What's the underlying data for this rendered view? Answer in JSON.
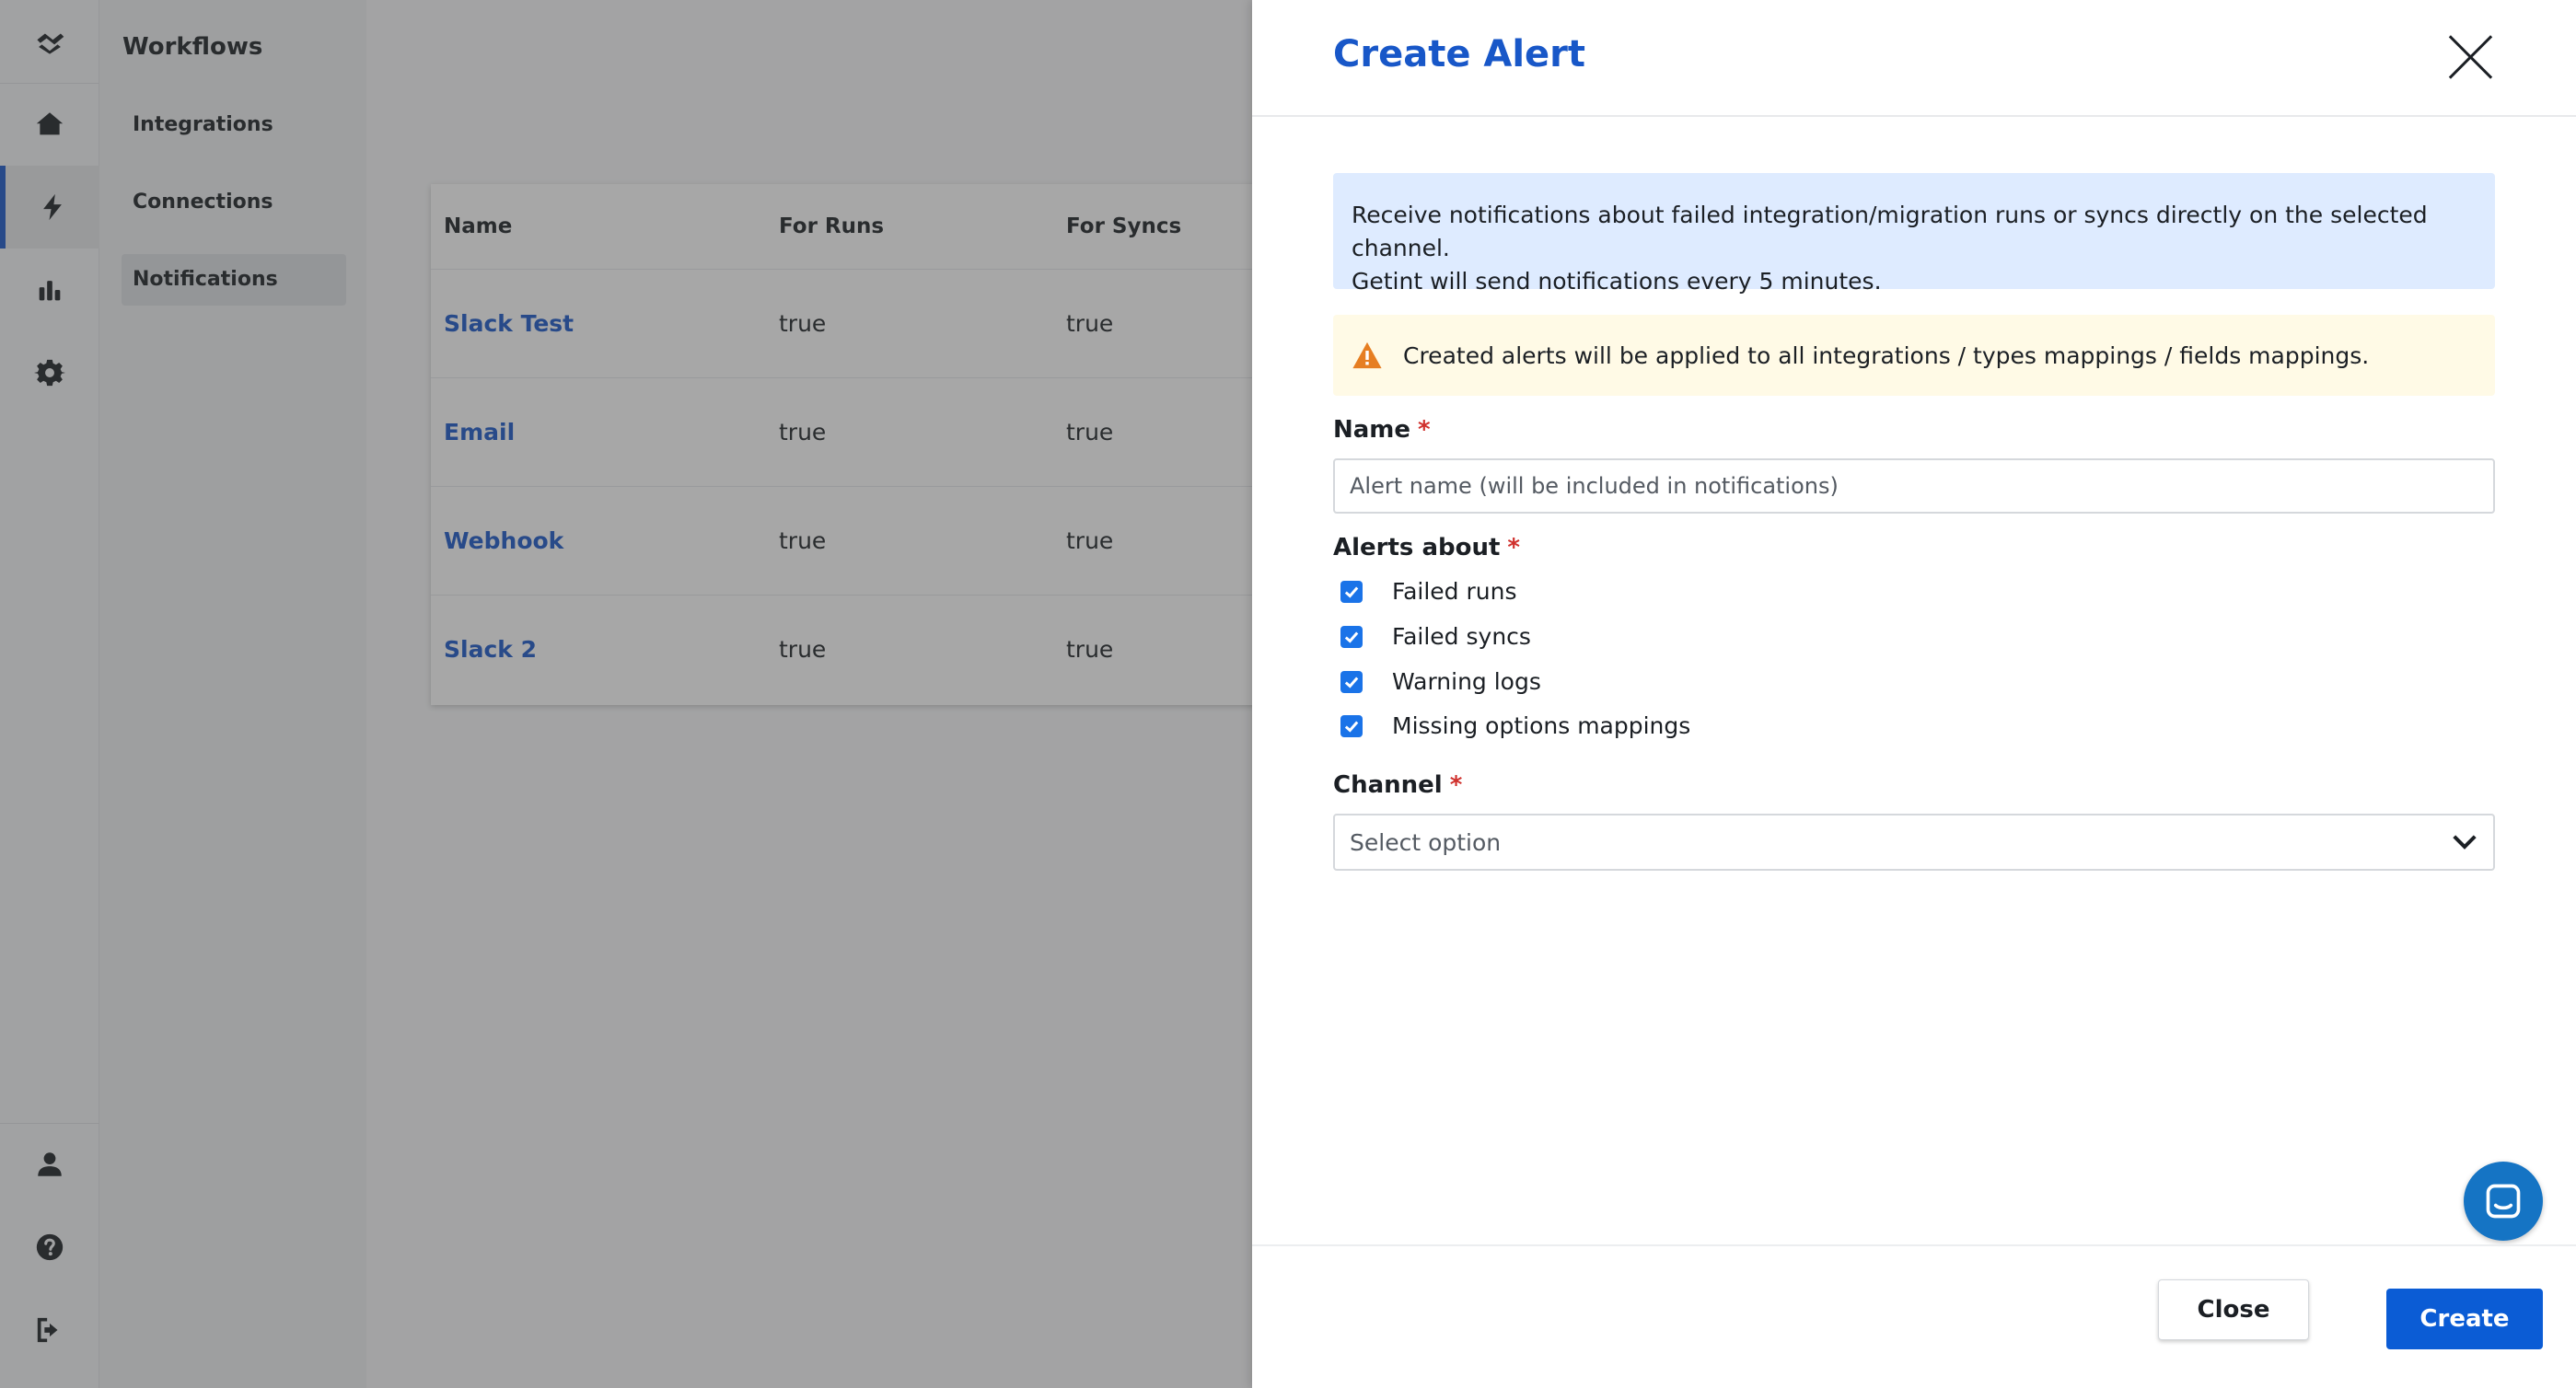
{
  "colors": {
    "accent": "#1857c8",
    "primary_button": "#0b5cd5",
    "info_bg": "#deebff",
    "warning_bg": "#fffae6",
    "warning_icon": "#e67e22",
    "checkbox": "#1a73e8",
    "required": "#d0312d"
  },
  "rail": {
    "icons": [
      "logo-icon",
      "home-icon",
      "bolt-icon",
      "bar-chart-icon",
      "gear-icon",
      "user-icon",
      "help-icon",
      "logout-icon"
    ]
  },
  "subnav": {
    "title": "Workflows",
    "items": [
      {
        "label": "Integrations"
      },
      {
        "label": "Connections"
      },
      {
        "label": "Notifications",
        "active": true
      }
    ]
  },
  "table": {
    "columns": [
      "Name",
      "For Runs",
      "For Syncs"
    ],
    "rows": [
      {
        "name": "Slack Test",
        "for_runs": "true",
        "for_syncs": "true"
      },
      {
        "name": "Email",
        "for_runs": "true",
        "for_syncs": "true"
      },
      {
        "name": "Webhook",
        "for_runs": "true",
        "for_syncs": "true"
      },
      {
        "name": "Slack 2",
        "for_runs": "true",
        "for_syncs": "true"
      }
    ]
  },
  "drawer": {
    "title": "Create Alert",
    "info_line1": "Receive notifications about failed integration/migration runs or syncs directly on the selected channel.",
    "info_line2": "Getint will send notifications every 5 minutes.",
    "warning": "Created alerts will be applied to all integrations / types mappings / fields mappings.",
    "name_label": "Name",
    "required_mark": "*",
    "name_placeholder": "Alert name (will be included in notifications)",
    "name_value": "",
    "alerts_label": "Alerts about",
    "alerts": [
      {
        "label": "Failed runs",
        "checked": true
      },
      {
        "label": "Failed syncs",
        "checked": true
      },
      {
        "label": "Warning logs",
        "checked": true
      },
      {
        "label": "Missing options mappings",
        "checked": true
      }
    ],
    "channel_label": "Channel",
    "channel_placeholder": "Select option",
    "close_button": "Close",
    "create_button": "Create"
  }
}
